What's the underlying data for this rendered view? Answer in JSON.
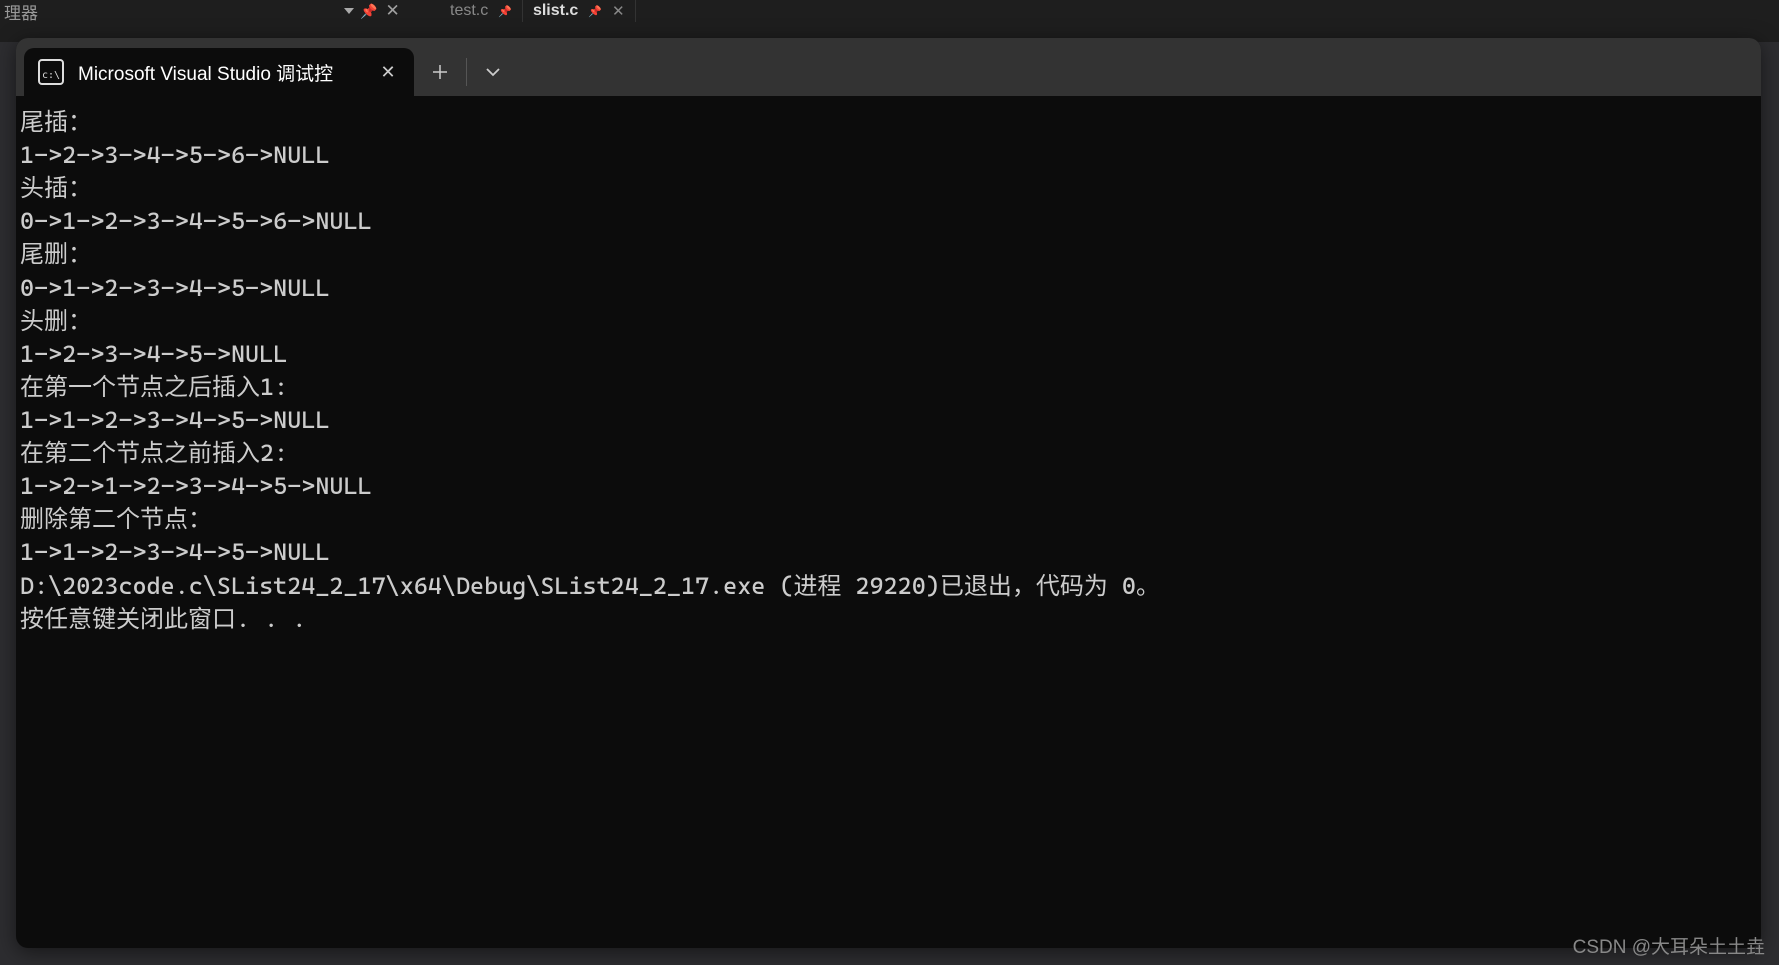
{
  "ide": {
    "panel_label": "理器",
    "tabs": [
      {
        "label": "test.c",
        "active": false
      },
      {
        "label": "slist.c",
        "active": true
      }
    ]
  },
  "terminal": {
    "tab_title": "Microsoft Visual Studio 调试控",
    "output_lines": [
      "尾插：",
      "1->2->3->4->5->6->NULL",
      "头插：",
      "0->1->2->3->4->5->6->NULL",
      "尾删：",
      "0->1->2->3->4->5->NULL",
      "头删：",
      "1->2->3->4->5->NULL",
      "在第一个节点之后插入1:",
      "1->1->2->3->4->5->NULL",
      "在第二个节点之前插入2:",
      "1->2->1->2->3->4->5->NULL",
      "删除第二个节点：",
      "1->1->2->3->4->5->NULL",
      "D:\\2023code.c\\SList24_2_17\\x64\\Debug\\SList24_2_17.exe (进程 29220)已退出，代码为 0。",
      "按任意键关闭此窗口. . ."
    ]
  },
  "watermark": "CSDN @大耳朵土土垚"
}
